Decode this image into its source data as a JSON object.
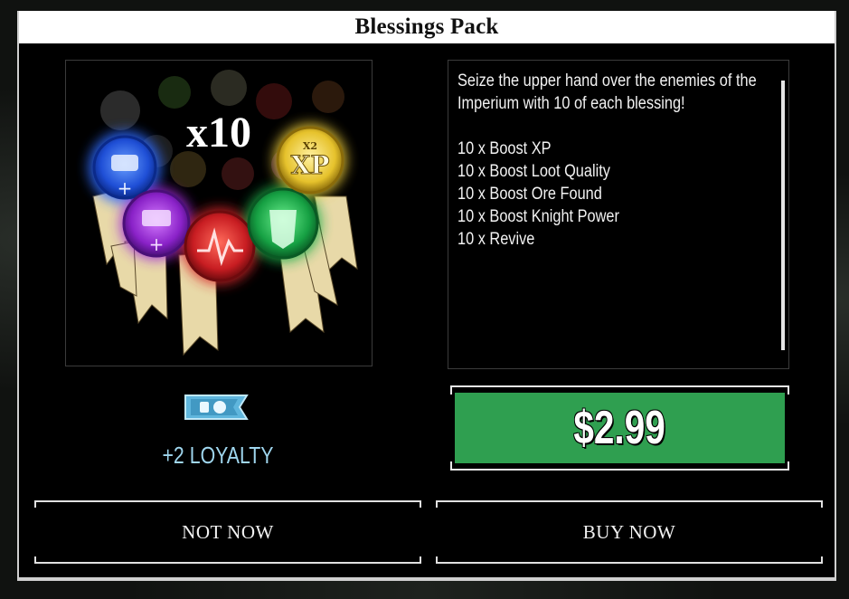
{
  "dialog": {
    "title": "Blessings Pack",
    "artwork": {
      "multiplier_label": "x10",
      "seal_xp_text": "XP",
      "seal_xp_sub": "X2"
    },
    "description": "Seize the upper hand over the enemies of the Imperium with 10 of each blessing!\n\n10 x Boost XP\n10 x Boost Loot Quality\n10 x Boost Ore Found\n10 x Boost Knight Power\n10 x Revive",
    "loyalty_label": "+2 LOYALTY",
    "price_label": "$2.99",
    "not_now_label": "NOT NOW",
    "buy_now_label": "BUY NOW"
  },
  "colors": {
    "price_button": "#2f9f50",
    "loyalty_text": "#9fd6ee",
    "seal_blue": "#2d6bff",
    "seal_purple": "#a02bd8",
    "seal_red": "#d8262a",
    "seal_green": "#1fae4a",
    "seal_gold": "#f0cf3a"
  }
}
